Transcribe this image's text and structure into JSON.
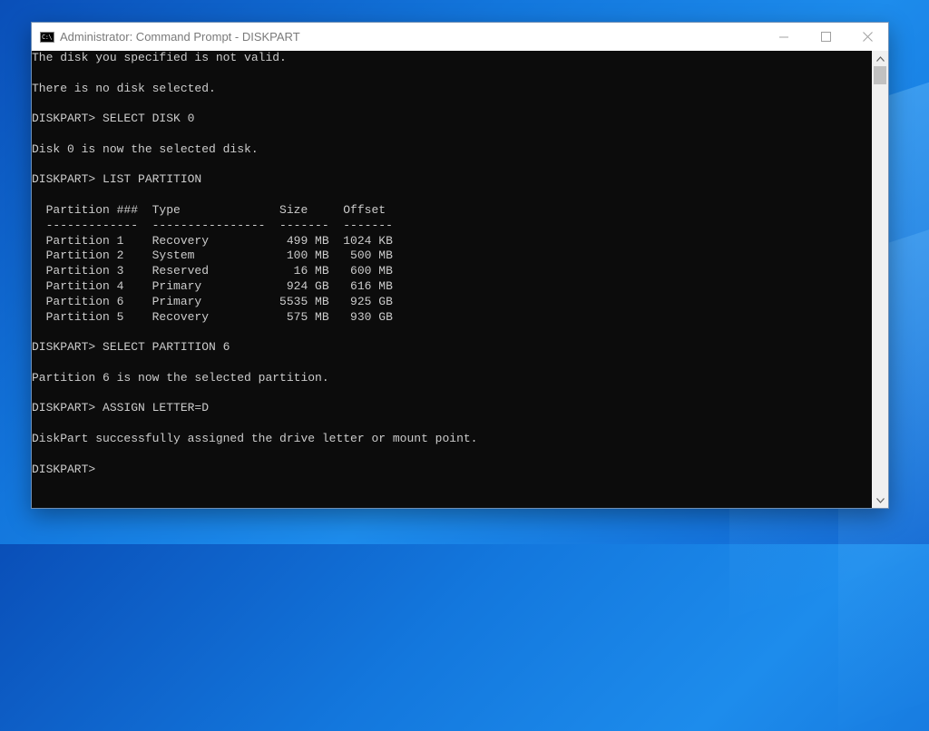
{
  "window": {
    "title": "Administrator: Command Prompt - DISKPART",
    "icon_text": "C:\\"
  },
  "console": {
    "lines": [
      "The disk you specified is not valid.",
      "",
      "There is no disk selected.",
      "",
      "DISKPART> SELECT DISK 0",
      "",
      "Disk 0 is now the selected disk.",
      "",
      "DISKPART> LIST PARTITION",
      "",
      "  Partition ###  Type              Size     Offset",
      "  -------------  ----------------  -------  -------",
      "  Partition 1    Recovery           499 MB  1024 KB",
      "  Partition 2    System             100 MB   500 MB",
      "  Partition 3    Reserved            16 MB   600 MB",
      "  Partition 4    Primary            924 GB   616 MB",
      "  Partition 6    Primary           5535 MB   925 GB",
      "  Partition 5    Recovery           575 MB   930 GB",
      "",
      "DISKPART> SELECT PARTITION 6",
      "",
      "Partition 6 is now the selected partition.",
      "",
      "DISKPART> ASSIGN LETTER=D",
      "",
      "DiskPart successfully assigned the drive letter or mount point.",
      "",
      "DISKPART> "
    ]
  },
  "icons": {
    "app": "command-prompt-icon",
    "minimize": "minimize-icon",
    "maximize": "maximize-icon",
    "close": "close-icon",
    "scroll_up": "scroll-up-arrow-icon",
    "scroll_down": "scroll-down-arrow-icon"
  },
  "colors": {
    "console_bg": "#0c0c0c",
    "console_text": "#cccccc",
    "titlebar_bg": "#ffffff",
    "desktop_accent": "#1377dd"
  }
}
